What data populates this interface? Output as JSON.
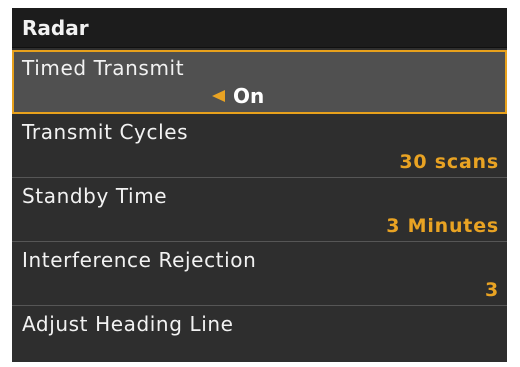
{
  "header": {
    "title": "Radar"
  },
  "menu": {
    "items": [
      {
        "label": "Timed Transmit",
        "value": "On"
      },
      {
        "label": "Transmit Cycles",
        "value": "30 scans"
      },
      {
        "label": "Standby Time",
        "value": "3 Minutes"
      },
      {
        "label": "Interference Rejection",
        "value": "3"
      },
      {
        "label": "Adjust Heading Line"
      }
    ]
  },
  "colors": {
    "accent": "#e9a323",
    "background": "#2e2e2e",
    "header_background": "#1c1c1c",
    "selected_background": "#505050"
  },
  "icons": {
    "toggle_arrow": "left-arrow-icon"
  }
}
